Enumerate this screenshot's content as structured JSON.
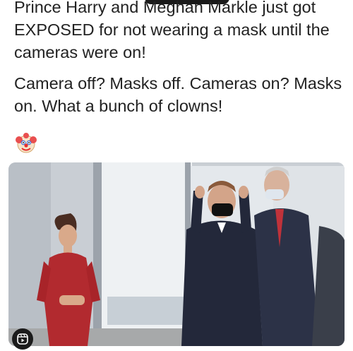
{
  "post": {
    "paragraph_1": "Prince Harry and Meghan Markle just got EXPOSED for not wearing a mask until the cameras were on!",
    "paragraph_2": "Camera off? Masks off. Cameras on? Masks on. What a bunch of clowns!",
    "emoji": "clown-face-emoji"
  },
  "video": {
    "badge_icon": "reels-icon"
  },
  "colors": {
    "text": "#222222",
    "red_dress": "#b22a2f",
    "suit": "#23283a",
    "window": "#e8ecef"
  }
}
